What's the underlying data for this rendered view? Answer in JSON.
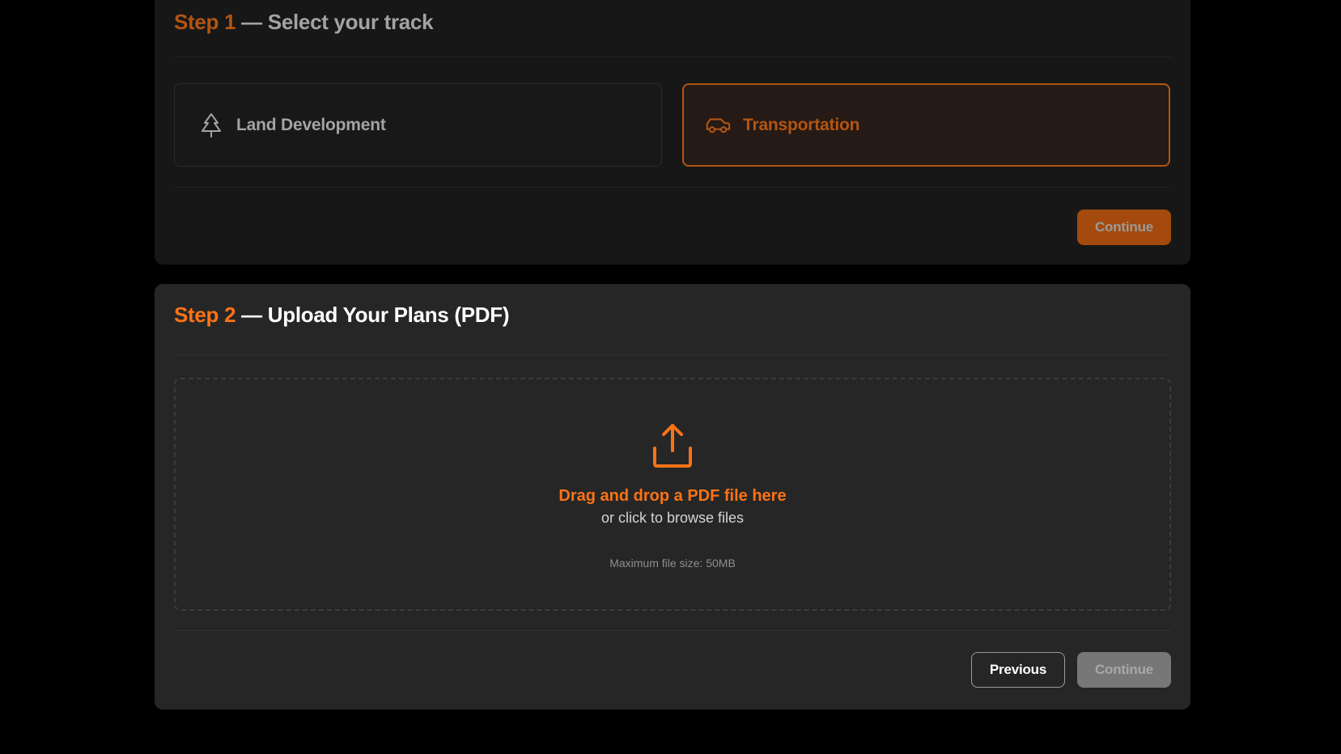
{
  "step1": {
    "step_label": "Step 1",
    "title": "— Select your track",
    "tracks": [
      {
        "label": "Land Development",
        "icon": "tree-icon",
        "selected": false
      },
      {
        "label": "Transportation",
        "icon": "car-icon",
        "selected": true
      }
    ],
    "continue_label": "Continue"
  },
  "step2": {
    "step_label": "Step 2",
    "title": "— Upload Your Plans (PDF)",
    "dropzone": {
      "icon": "upload-icon",
      "title": "Drag and drop a PDF file here",
      "subtitle": "or click to browse files",
      "note": "Maximum file size: 50MB"
    },
    "previous_label": "Previous",
    "continue_label": "Continue"
  },
  "colors": {
    "accent": "#f97316",
    "accent_dim": "#b35512",
    "background": "#000000",
    "card_active": "#262626",
    "card_inactive": "#171717"
  }
}
